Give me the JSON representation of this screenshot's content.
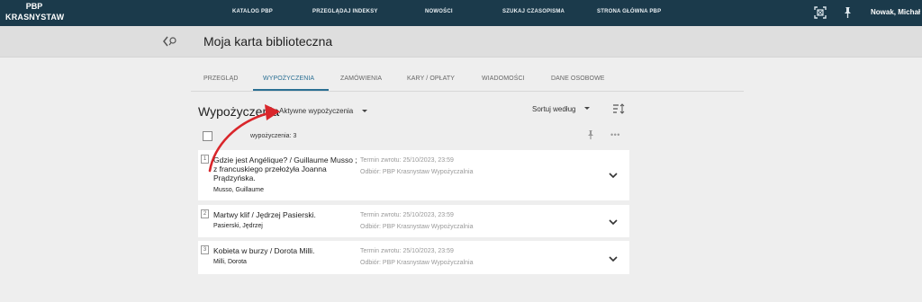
{
  "topbar": {
    "logo_line1": "PBP",
    "logo_line2": "KRASNYSTAW",
    "nav": [
      "KATALOG PBP",
      "PRZEGLĄDAJ INDEKSY",
      "NOWOŚCI",
      "SZUKAJ CZASOPISMA",
      "STRONA GŁÓWNA PBP"
    ],
    "user": "Nowak, Michał",
    "icons": [
      "qr-scan-icon",
      "pin-icon"
    ]
  },
  "header": {
    "back_icon": "back-search-icon",
    "title": "Moja karta biblioteczna"
  },
  "tabs": [
    "PRZEGLĄD",
    "WYPOŻYCZENIA",
    "ZAMÓWIENIA",
    "KARY / OPŁATY",
    "WIADOMOŚCI",
    "DANE OSOBOWE"
  ],
  "active_tab": "WYPOŻYCZENIA",
  "section": {
    "title": "Wypożyczenia",
    "filter": "Aktywne wypożyczenia",
    "sort": "Sortuj według",
    "count_text": "wypożyczenia: 3"
  },
  "loans": [
    {
      "number": "1",
      "title": "Gdzie jest Angélique? / Guillaume Musso ; z francuskiego przełożyła Joanna Prądzyńska.",
      "author": "Musso, Guillaume",
      "due": "Termin zwrotu: 25/10/2023, 23:59",
      "pickup": "Odbiór: PBP Krasnystaw Wypożyczalnia"
    },
    {
      "number": "2",
      "title": "Martwy klif / Jędrzej Pasierski.",
      "author": "Pasierski, Jędrzej",
      "due": "Termin zwrotu: 25/10/2023, 23:59",
      "pickup": "Odbiór: PBP Krasnystaw Wypożyczalnia"
    },
    {
      "number": "3",
      "title": "Kobieta w burzy / Dorota Milli.",
      "author": "Milli, Dorota",
      "due": "Termin zwrotu: 25/10/2023, 23:59",
      "pickup": "Odbiór: PBP Krasnystaw Wypożyczalnia"
    }
  ],
  "colors": {
    "topbar": "#1b3a4b",
    "accent": "#2a6f93",
    "annotation_arrow": "#d9262b"
  }
}
